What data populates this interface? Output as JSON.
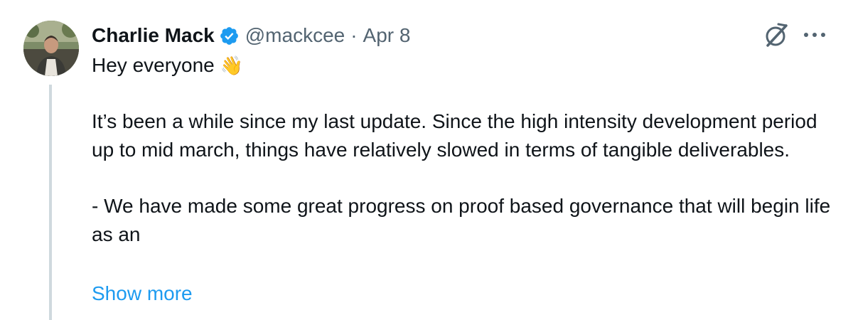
{
  "tweet": {
    "author": {
      "display_name": "Charlie Mack",
      "handle": "@mackcee",
      "verified": true,
      "verified_icon": "verified-badge-icon",
      "verified_color": "#1d9bf0"
    },
    "separator": "·",
    "date": "Apr 8",
    "actions": {
      "grok_icon": "grok-icon",
      "more_icon": "more-horizontal-icon"
    },
    "body": {
      "greeting": "Hey everyone",
      "greeting_emoji": "👋",
      "paragraph_1": "It’s been a while since my last update. Since the high intensity development period up to mid march, things have relatively slowed in terms of tangible deliverables.",
      "paragraph_2": "- We have made some great progress on proof based governance that will begin life as an"
    },
    "show_more_label": "Show more",
    "colors": {
      "text": "#0f1419",
      "secondary": "#536471",
      "link": "#1d9bf0",
      "thread_line": "#cfd9de"
    }
  }
}
